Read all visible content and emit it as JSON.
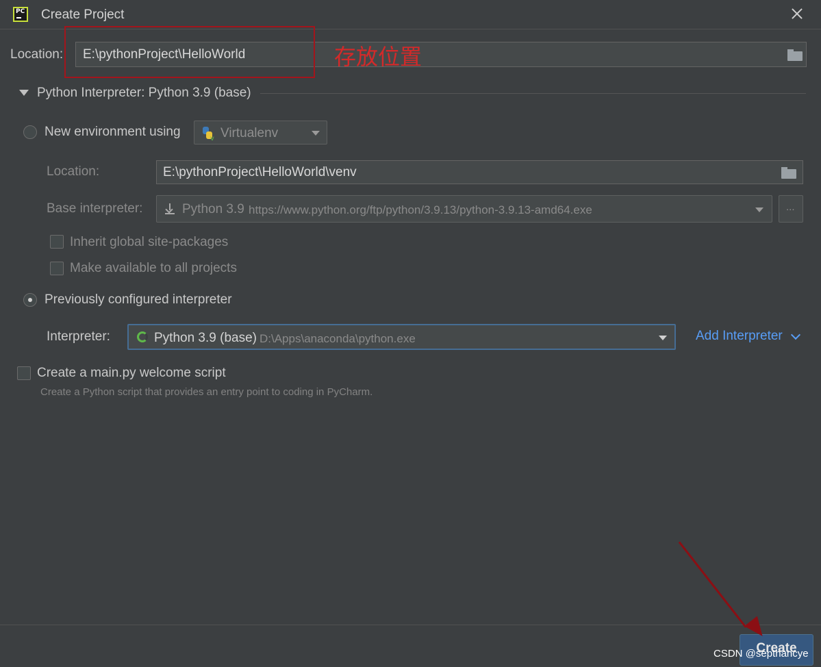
{
  "window": {
    "title": "Create Project",
    "close_label": "×"
  },
  "location": {
    "label": "Location:",
    "value": "E:\\pythonProject\\HelloWorld"
  },
  "annotation": {
    "text": "存放位置"
  },
  "interpreter_section": {
    "header": "Python Interpreter: Python 3.9 (base)"
  },
  "new_env": {
    "label": "New environment using",
    "tool": "Virtualenv",
    "location_label": "Location:",
    "location_value": "E:\\pythonProject\\HelloWorld\\venv",
    "base_label": "Base interpreter:",
    "base_name": "Python 3.9",
    "base_url": "https://www.python.org/ftp/python/3.9.13/python-3.9.13-amd64.exe",
    "browse_label": "...",
    "inherit_label": "Inherit global site-packages",
    "make_available_label": "Make available to all projects"
  },
  "prev_configured": {
    "label": "Previously configured interpreter",
    "interpreter_label": "Interpreter:",
    "interpreter_name": "Python 3.9 (base)",
    "interpreter_path": "D:\\Apps\\anaconda\\python.exe",
    "add_label": "Add Interpreter"
  },
  "welcome_script": {
    "label": "Create a main.py welcome script",
    "hint": "Create a Python script that provides an entry point to coding in PyCharm."
  },
  "footer": {
    "create_label": "Create",
    "watermark": "CSDN @septhancye"
  },
  "colors": {
    "background": "#3c3f41",
    "accent": "#589df6",
    "annotation": "#d22a2a",
    "button": "#365880"
  },
  "icons": [
    "pycharm-logo-icon",
    "close-icon",
    "folder-icon",
    "python-virtualenv-icon",
    "download-icon",
    "conda-spinner-icon",
    "chevron-down-icon"
  ]
}
